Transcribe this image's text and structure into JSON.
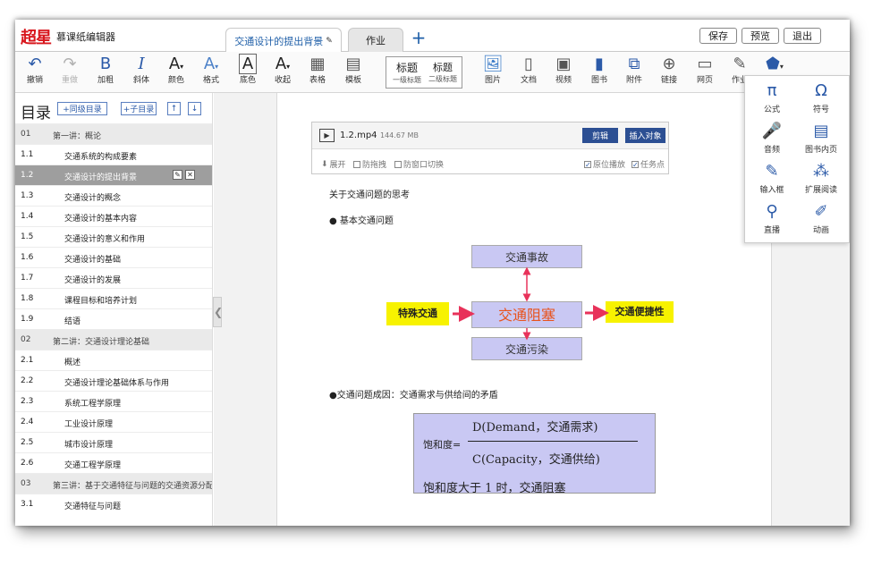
{
  "app": {
    "logo": "超星",
    "title": "慕课纸编辑器"
  },
  "tabs": [
    {
      "label": "交通设计的提出背景",
      "edit_icon": "pencil-icon"
    },
    {
      "label": "作业"
    }
  ],
  "tab_add": "+",
  "header_buttons": {
    "save": "保存",
    "preview": "预览",
    "exit": "退出"
  },
  "toolbar": {
    "undo": "撤销",
    "redo": "重做",
    "bold": "加粗",
    "italic": "斜体",
    "color": "颜色",
    "format": "格式",
    "bgcolor": "底色",
    "collapse": "收起",
    "table": "表格",
    "template": "模板",
    "h1": "标题",
    "h1_label": "一级标题",
    "h2": "标题",
    "h2_label": "二级标题",
    "image": "图片",
    "doc": "文档",
    "video": "视频",
    "book": "图书",
    "attach": "附件",
    "link": "链接",
    "webpage": "网页",
    "homework": "作业",
    "widget": "组件"
  },
  "widgets": [
    {
      "label": "公式",
      "icon": "π"
    },
    {
      "label": "符号",
      "icon": "Ω"
    },
    {
      "label": "音频",
      "icon": "🎤"
    },
    {
      "label": "图书内页",
      "icon": "▤"
    },
    {
      "label": "输入框",
      "icon": "✎"
    },
    {
      "label": "扩展阅读",
      "icon": "⁂"
    },
    {
      "label": "直播",
      "icon": "⚲"
    },
    {
      "label": "动画",
      "icon": "✐"
    }
  ],
  "sidebar": {
    "title": "目录",
    "add_same": "+同级目录",
    "add_sub": "+子目录",
    "rows": [
      {
        "num": "01",
        "text": "第一讲：概论",
        "type": "ch"
      },
      {
        "num": "1.1",
        "text": "交通系统的构成要素",
        "type": "item"
      },
      {
        "num": "1.2",
        "text": "交通设计的提出背景",
        "type": "sel"
      },
      {
        "num": "1.3",
        "text": "交通设计的概念",
        "type": "item"
      },
      {
        "num": "1.4",
        "text": "交通设计的基本内容",
        "type": "item"
      },
      {
        "num": "1.5",
        "text": "交通设计的意义和作用",
        "type": "item"
      },
      {
        "num": "1.6",
        "text": "交通设计的基础",
        "type": "item"
      },
      {
        "num": "1.7",
        "text": "交通设计的发展",
        "type": "item"
      },
      {
        "num": "1.8",
        "text": "课程目标和培养计划",
        "type": "item"
      },
      {
        "num": "1.9",
        "text": "结语",
        "type": "item"
      },
      {
        "num": "02",
        "text": "第二讲：交通设计理论基础",
        "type": "ch"
      },
      {
        "num": "2.1",
        "text": "概述",
        "type": "item"
      },
      {
        "num": "2.2",
        "text": "交通设计理论基础体系与作用",
        "type": "item"
      },
      {
        "num": "2.3",
        "text": "系统工程学原理",
        "type": "item"
      },
      {
        "num": "2.4",
        "text": "工业设计原理",
        "type": "item"
      },
      {
        "num": "2.5",
        "text": "城市设计原理",
        "type": "item"
      },
      {
        "num": "2.6",
        "text": "交通工程学原理",
        "type": "item"
      },
      {
        "num": "03",
        "text": "第三讲：基于交通特征与问题的交通资源分配设计",
        "type": "ch"
      },
      {
        "num": "3.1",
        "text": "交通特征与问题",
        "type": "item"
      }
    ]
  },
  "video": {
    "filename": "1.2.mp4",
    "size": "144.67 MB",
    "cut": "剪辑",
    "insert": "插入对象",
    "expand": "展开",
    "anti_drag": "防拖拽",
    "anti_switch": "防窗口切换",
    "resume": "原位播放",
    "task": "任务点"
  },
  "content": {
    "heading": "关于交通问题的思考",
    "bullet1": "● 基本交通问题",
    "accident": "交通事故",
    "jam": "交通阻塞",
    "pollution": "交通污染",
    "special": "特殊交通",
    "convenience": "交通便捷性",
    "bullet2": "●交通问题成因：交通需求与供给间的矛盾",
    "formula_lhs": "饱和度=",
    "numerator": "D(Demand，交通需求)",
    "denominator": "C(Capacity，交通供给)",
    "note": "饱和度大于 1 时，交通阻塞"
  },
  "colors": {
    "accent": "#2b5aa8",
    "button": "#2c4f93",
    "diagram": "#c9c8f3",
    "highlight": "#f7f200",
    "jam_text": "#e8531d",
    "arrow": "#e8325a"
  }
}
